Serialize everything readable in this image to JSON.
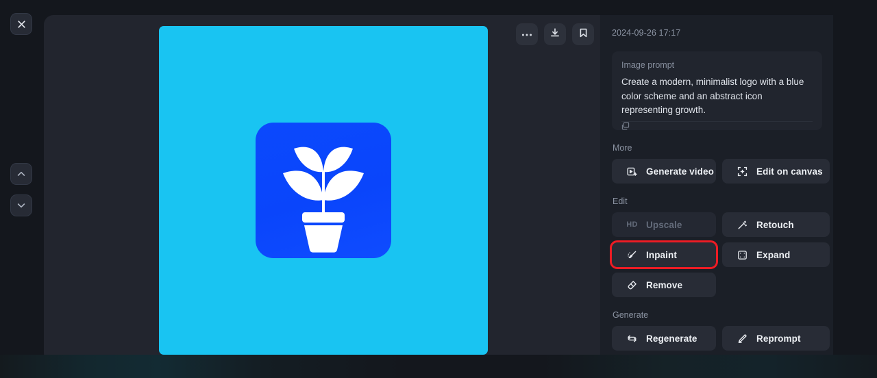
{
  "rail": {
    "close_label": "Close",
    "prev_label": "Previous image",
    "next_label": "Next image"
  },
  "toolbar": {
    "more_label": "More options",
    "download_label": "Download",
    "bookmark_label": "Bookmark"
  },
  "viewer": {
    "artwork_alt": "Minimalist blue logo with white potted plant",
    "background_color": "#19c4f2",
    "tile_color": "#0b49fd"
  },
  "info": {
    "timestamp": "2024-09-26 17:17",
    "prompt_label": "Image prompt",
    "prompt_text": "Create a modern, minimalist logo with a blue color scheme and an abstract icon representing growth.",
    "copy_label": "Copy prompt"
  },
  "sections": {
    "more": {
      "title": "More",
      "items": [
        {
          "label": "Generate video",
          "icon": "video-plus-icon",
          "disabled": false
        },
        {
          "label": "Edit on canvas",
          "icon": "canvas-transform-icon",
          "disabled": false
        }
      ]
    },
    "edit": {
      "title": "Edit",
      "items": [
        {
          "label": "Upscale",
          "icon": "hd-icon",
          "disabled": true
        },
        {
          "label": "Retouch",
          "icon": "magic-wand-icon",
          "disabled": false
        },
        {
          "label": "Inpaint",
          "icon": "paint-brush-icon",
          "disabled": false,
          "highlighted": true
        },
        {
          "label": "Expand",
          "icon": "expand-frame-icon",
          "disabled": false
        },
        {
          "label": "Remove",
          "icon": "eraser-icon",
          "disabled": false
        }
      ]
    },
    "generate": {
      "title": "Generate",
      "items": [
        {
          "label": "Regenerate",
          "icon": "refresh-icon",
          "disabled": false
        },
        {
          "label": "Reprompt",
          "icon": "pencil-icon",
          "disabled": false
        }
      ]
    }
  },
  "highlight": {
    "color": "#ed1c24"
  }
}
